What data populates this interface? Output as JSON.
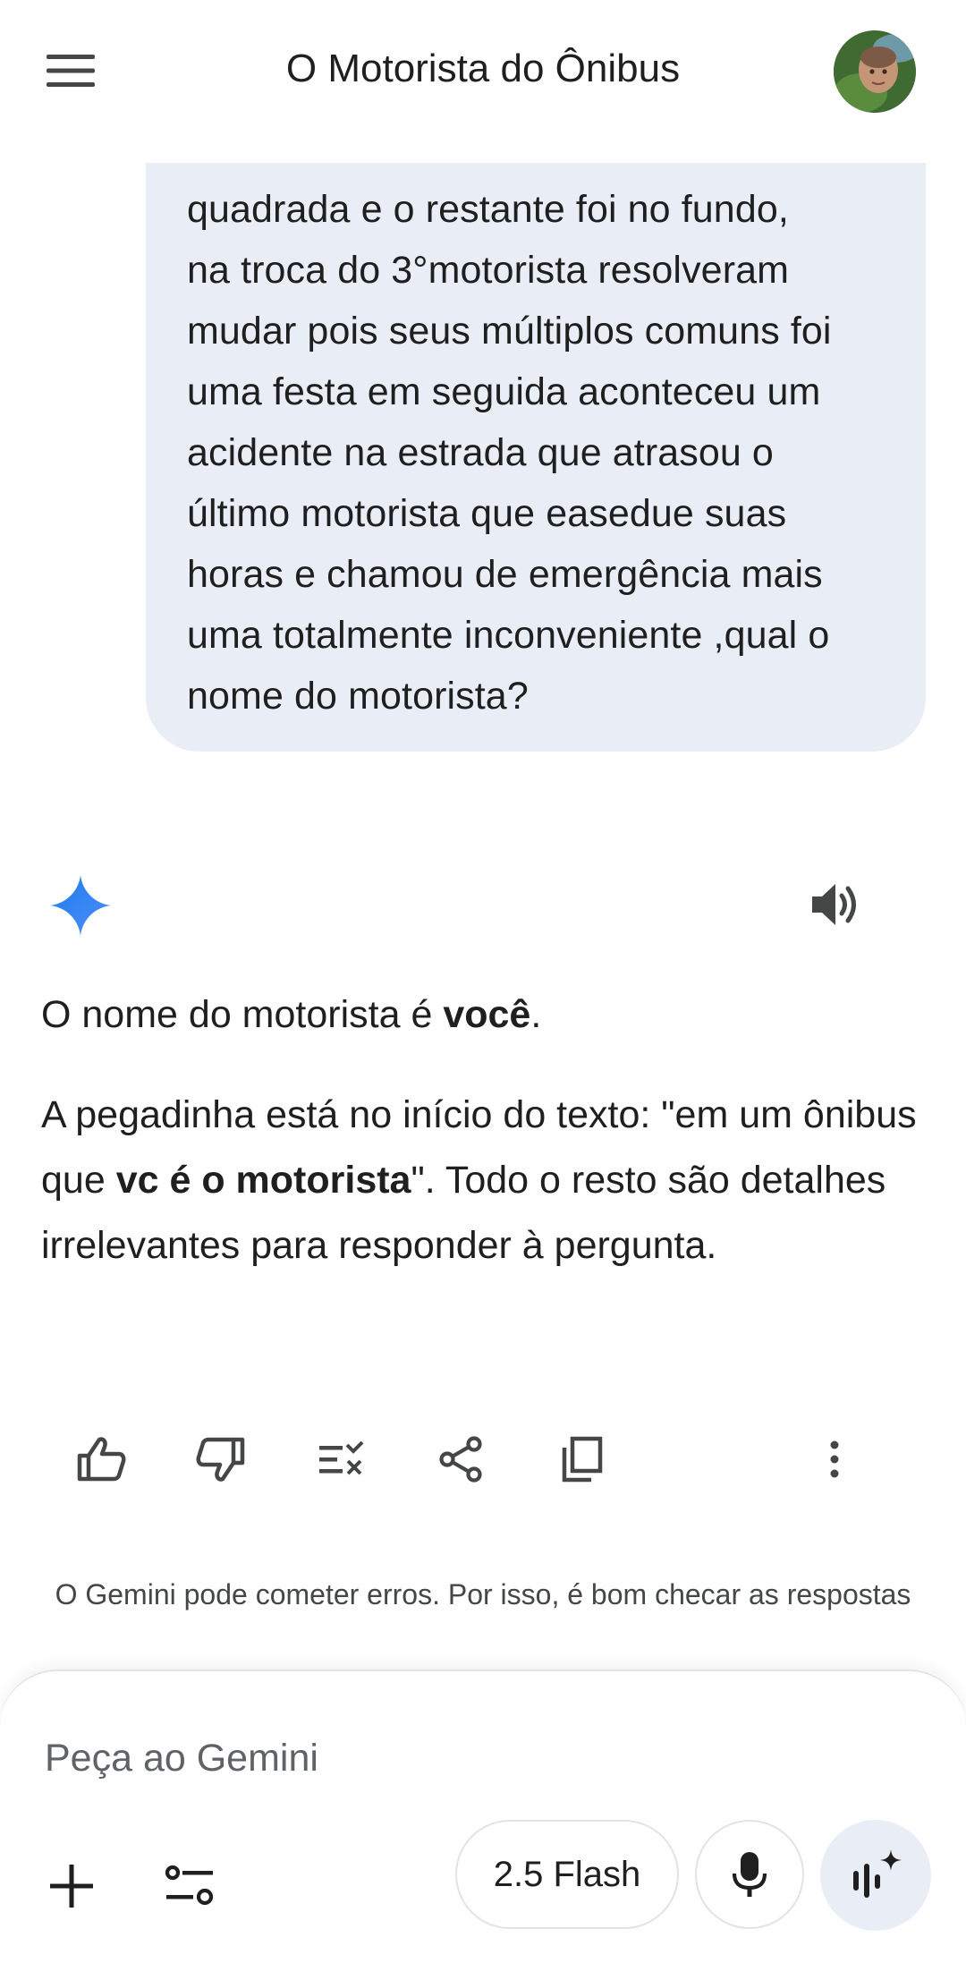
{
  "header": {
    "title": "O Motorista do Ônibus",
    "menu_icon": "hamburger-menu-icon",
    "avatar": "user-avatar"
  },
  "user_message": {
    "text": "quadrada e o restante foi no fundo,\nna troca do 3°motorista resolveram\nmudar pois seus múltiplos comuns foi\numa festa em seguida aconteceu um\nacidente na estrada que atrasou  o\núltimo motorista que easedue suas\nhoras e chamou de emergência mais\numa totalmente  inconveniente ,qual o\nnome do motorista?"
  },
  "response": {
    "p1_before": "O nome do motorista é ",
    "p1_bold": "você",
    "p1_after": ".",
    "p2_part1": "A pegadinha está no início do texto: \"em um ônibus que ",
    "p2_bold": "vc é o motorista",
    "p2_part2": "\". Todo o resto são detalhes irrelevantes para responder à pergunta."
  },
  "actions": [
    "thumbs-up-icon",
    "thumbs-down-icon",
    "modify-response-icon",
    "share-icon",
    "copy-icon",
    "more-vert-icon"
  ],
  "disclaimer": "O Gemini pode cometer erros. Por isso, é bom checar as respostas",
  "input": {
    "placeholder": "Peça ao Gemini",
    "model_label": "2.5 Flash"
  },
  "colors": {
    "bubble_bg": "#e9eef6",
    "gemini_spark": "#4285f4",
    "text": "#1f1f1f",
    "muted": "#444746"
  }
}
